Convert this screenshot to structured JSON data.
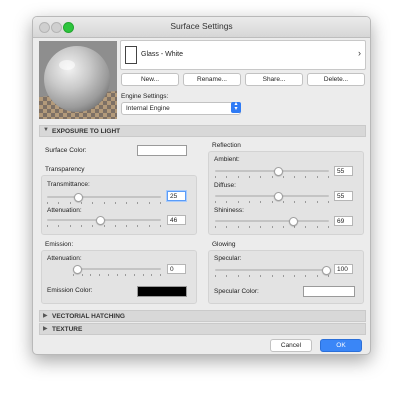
{
  "window": {
    "title": "Surface Settings"
  },
  "material": {
    "name": "Glass - White"
  },
  "buttons": {
    "new": "New...",
    "rename": "Rename...",
    "share": "Share...",
    "delete": "Delete..."
  },
  "engine": {
    "label": "Engine Settings:",
    "value": "Internal Engine"
  },
  "sections": {
    "exposure": "EXPOSURE TO LIGHT",
    "hatching": "VECTORIAL HATCHING",
    "texture": "TEXTURE"
  },
  "surface_color": {
    "label": "Surface Color:",
    "color": "#ffffff"
  },
  "transparency": {
    "title": "Transparency",
    "transmittance": {
      "label": "Transmittance:",
      "value": "25",
      "level": 0.25
    },
    "attenuation": {
      "label": "Attenuation:",
      "value": "46",
      "level": 0.46
    }
  },
  "reflection": {
    "title": "Reflection",
    "ambient": {
      "label": "Ambient:",
      "value": "55",
      "level": 0.55
    },
    "diffuse": {
      "label": "Diffuse:",
      "value": "55",
      "level": 0.55
    },
    "shininess": {
      "label": "Shininess:",
      "value": "69",
      "level": 0.69
    }
  },
  "emission": {
    "title": "Emission:",
    "attenuation": {
      "label": "Attenuation:",
      "value": "0",
      "level": 0.0
    },
    "color": {
      "label": "Emission Color:",
      "color": "#000000"
    }
  },
  "glowing": {
    "title": "Glowing",
    "specular": {
      "label": "Specular:",
      "value": "100",
      "level": 1.0
    },
    "color": {
      "label": "Specular Color:",
      "color": "#ffffff"
    }
  },
  "footer": {
    "cancel": "Cancel",
    "ok": "OK"
  },
  "colors": {
    "accent": "#2f7bf5",
    "ok_button": "#3a86f7"
  }
}
